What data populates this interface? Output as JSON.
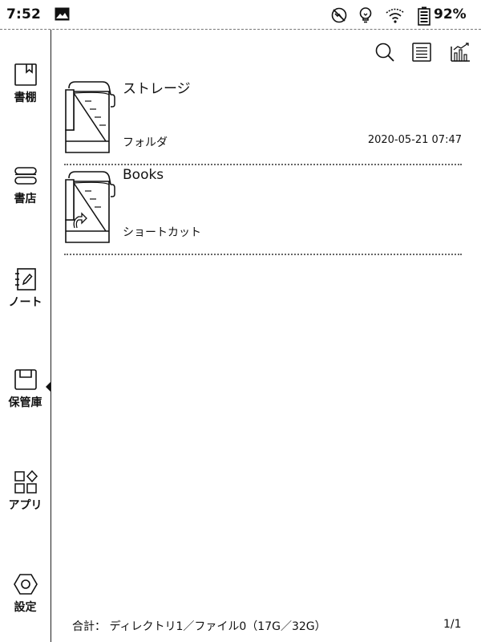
{
  "status_bar": {
    "time": "7:52",
    "battery": "92%",
    "icons": [
      "image-icon",
      "sync-off-icon",
      "bulb-icon",
      "wifi-icon",
      "battery-icon"
    ]
  },
  "sidebar": {
    "items": [
      {
        "id": "bookshelf",
        "label": "書棚",
        "icon": "bookmark-book-icon"
      },
      {
        "id": "store",
        "label": "書店",
        "icon": "store-icon"
      },
      {
        "id": "notes",
        "label": "ノート",
        "icon": "note-pen-icon"
      },
      {
        "id": "storage",
        "label": "保管庫",
        "icon": "storage-box-icon",
        "active": true
      },
      {
        "id": "apps",
        "label": "アプリ",
        "icon": "apps-grid-icon"
      },
      {
        "id": "settings",
        "label": "設定",
        "icon": "settings-hex-icon"
      }
    ]
  },
  "toolbar": {
    "icons": [
      "search-icon",
      "list-view-icon",
      "stats-icon"
    ]
  },
  "files": [
    {
      "name": "ストレージ",
      "type": "フォルダ",
      "date": "2020-05-21 07:47",
      "icon": "folder-icon"
    },
    {
      "name": "Books",
      "type": "ショートカット",
      "date": "",
      "icon": "folder-shortcut-icon"
    }
  ],
  "footer": {
    "summary": "合計： ディレクトリ1／ファイル0（17G／32G）",
    "page": "1/1"
  },
  "colors": {
    "ink": "#111111",
    "background": "#ffffff"
  }
}
